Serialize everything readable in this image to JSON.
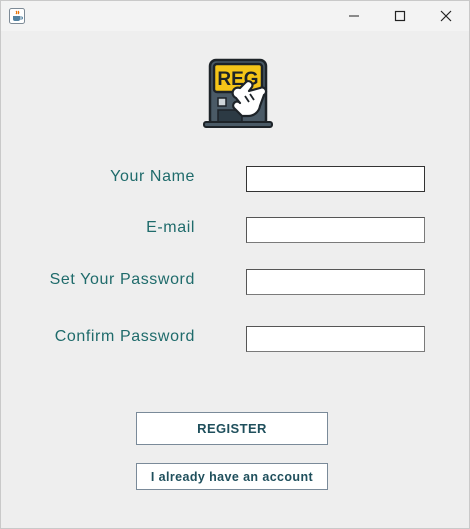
{
  "window": {
    "icon": "java-cup-icon",
    "controls": [
      "minimize-icon",
      "maximize-icon",
      "close-icon"
    ]
  },
  "logo": {
    "text": "REG",
    "icon": "registration-machine-hand-icon",
    "colors": {
      "badge": "#f5c518",
      "body": "#4a5a66",
      "screen": "#2c3a44"
    }
  },
  "form": {
    "name_label": "Your Name",
    "email_label": "E-mail",
    "password_label": "Set Your Password",
    "confirm_label": "Confirm Password",
    "name_value": "",
    "email_value": "",
    "password_value": "",
    "confirm_value": ""
  },
  "buttons": {
    "register": "REGISTER",
    "have_account": "I already have an account"
  },
  "colors": {
    "label": "#1f6b6b",
    "button_text": "#1f4f5c"
  }
}
